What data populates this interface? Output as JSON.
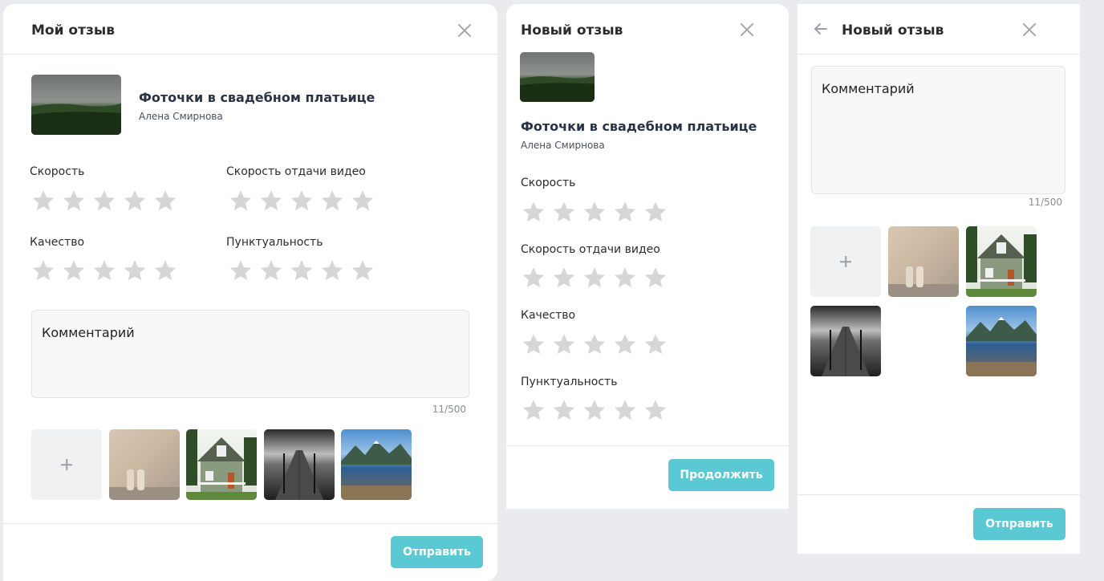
{
  "colors": {
    "accent": "#5bc9d3",
    "star_empty": "#d6d6d6",
    "background": "#eaebee"
  },
  "panel1": {
    "title": "Мой отзыв",
    "product": {
      "title": "Фоточки в свадебном платьице",
      "author": "Алена Смирнова"
    },
    "ratings": [
      {
        "label": "Скорость",
        "stars": 0,
        "max": 5
      },
      {
        "label": "Скорость отдачи видео",
        "stars": 0,
        "max": 5
      },
      {
        "label": "Качество",
        "stars": 0,
        "max": 5
      },
      {
        "label": "Пунктуальность",
        "stars": 0,
        "max": 5
      }
    ],
    "comment": {
      "placeholder": "Комментарий",
      "counter": "11/500"
    },
    "submit_label": "Отправить"
  },
  "panel2": {
    "title": "Новый отзыв",
    "product": {
      "title": "Фоточки в свадебном платьице",
      "author": "Алена Смирнова"
    },
    "ratings": [
      {
        "label": "Скорость",
        "stars": 0,
        "max": 5
      },
      {
        "label": "Скорость отдачи видео",
        "stars": 0,
        "max": 5
      },
      {
        "label": "Качество",
        "stars": 0,
        "max": 5
      },
      {
        "label": "Пунктуальность",
        "stars": 0,
        "max": 5
      }
    ],
    "continue_label": "Продолжить"
  },
  "panel3": {
    "title": "Новый отзыв",
    "comment": {
      "placeholder": "Комментарий",
      "counter": "11/500"
    },
    "submit_label": "Отправить"
  },
  "icons": {
    "close": "close-icon",
    "back": "arrow-left-icon",
    "add": "plus-icon",
    "star": "star-icon"
  }
}
